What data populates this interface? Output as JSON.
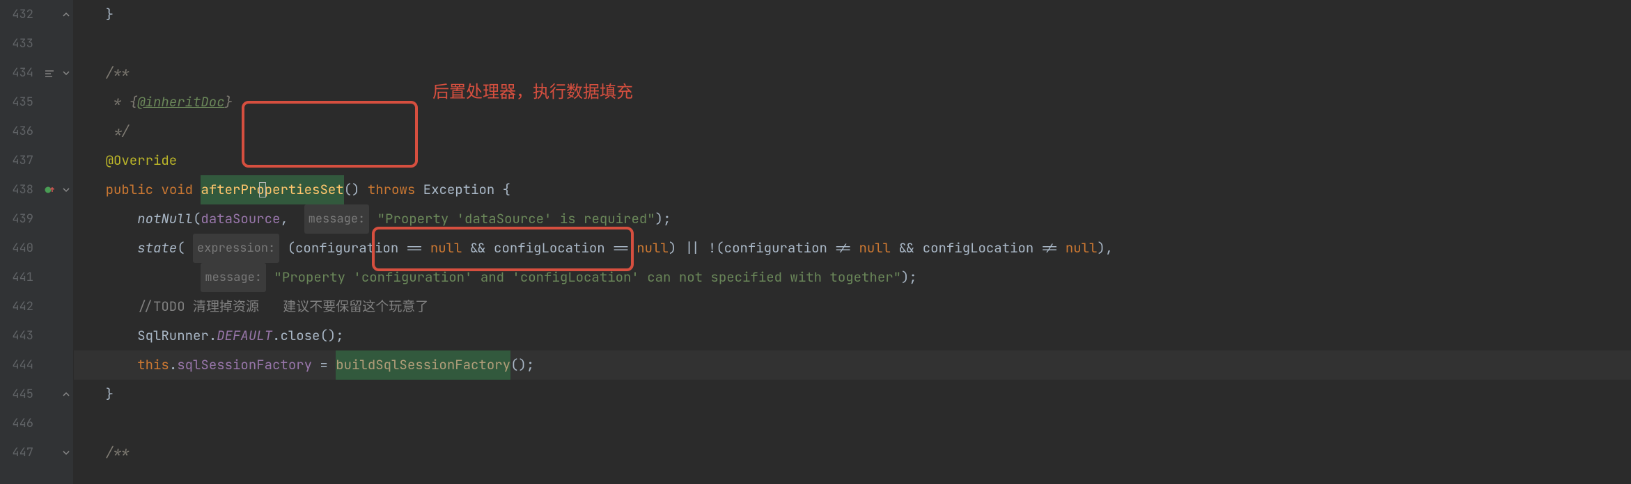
{
  "annotation": {
    "text": "后置处理器，执行数据填充"
  },
  "gutter": {
    "lines": [
      "432",
      "433",
      "434",
      "435",
      "436",
      "437",
      "438",
      "439",
      "440",
      "441",
      "442",
      "443",
      "444",
      "445",
      "446",
      "447"
    ]
  },
  "code": {
    "l432": "    }",
    "l433": "",
    "l434_a": "    ",
    "l434_b": "/**",
    "l435_a": "     * {",
    "l435_b": "@inheritDoc",
    "l435_c": "}",
    "l436_a": "     */",
    "l437_a": "    ",
    "l437_b": "@Override",
    "l438_pad": "    ",
    "l438_kw1": "public",
    "l438_kw2": "void",
    "l438_name": "afterPropertiesSet",
    "l438_paren": "()",
    "l438_throws": "throws",
    "l438_exc": "Exception {",
    "l439_pad": "        ",
    "l439_call": "notNull",
    "l439_open": "(",
    "l439_arg1": "dataSource",
    "l439_comma": ",  ",
    "l439_hint": "message:",
    "l439_sp": " ",
    "l439_str": "\"Property 'dataSource' is required\"",
    "l439_end": ");",
    "l440_pad": "        ",
    "l440_call": "state",
    "l440_open": "( ",
    "l440_hint": "expression:",
    "l440_expr": " (configuration == ",
    "l440_null1": "null",
    "l440_and1": " && configLocation == ",
    "l440_null2": "null",
    "l440_mid": ") || !(configuration != ",
    "l440_null3": "null",
    "l440_and2": " && configLocation != ",
    "l440_null4": "null",
    "l440_close": "),",
    "l441_pad": "                ",
    "l441_hint": "message:",
    "l441_sp": " ",
    "l441_str": "\"Property 'configuration' and 'configLocation' can not specified with together\"",
    "l441_end": ");",
    "l442_pad": "        ",
    "l442_cmt": "//TODO 清理掉资源   建议不要保留这个玩意了",
    "l443_pad": "        ",
    "l443_cls": "SqlRunner",
    "l443_dot1": ".",
    "l443_def": "DEFAULT",
    "l443_dot2": ".",
    "l443_close": "close();",
    "l444_pad": "        ",
    "l444_this": "this",
    "l444_dot": ".",
    "l444_fld": "sqlSessionFactory",
    "l444_eq": " = ",
    "l444_call": "buildSqlSessionFactory",
    "l444_end": "();",
    "l445": "    }",
    "l446": "",
    "l447_a": "    ",
    "l447_b": "/**"
  }
}
